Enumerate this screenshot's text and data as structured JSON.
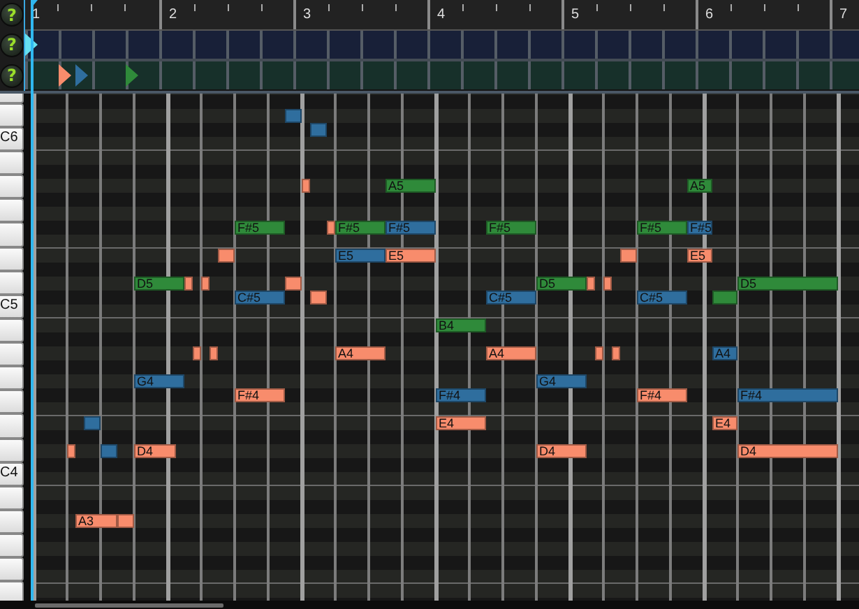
{
  "track_buttons": [
    {
      "symbol": "?"
    },
    {
      "symbol": "?"
    },
    {
      "symbol": "?"
    }
  ],
  "ruler": {
    "bars": [
      "1",
      "2",
      "3",
      "4",
      "5",
      "6",
      "7"
    ]
  },
  "tracks": [
    {
      "color": "#182038",
      "markers": [
        {
          "color": "#66e0f0"
        }
      ]
    },
    {
      "color": "#17302a",
      "markers": [
        {
          "color": "#f88c6c"
        },
        {
          "color": "#2f6e9e"
        },
        {
          "color": "#2f8a3a"
        }
      ]
    }
  ],
  "keyboard": {
    "labels": [
      "C6",
      "C5",
      "C4"
    ]
  },
  "notes": [
    {
      "color": "#2f6e9e"
    },
    {
      "color": "#2f6e9e"
    },
    {
      "color": "#f88c6c"
    },
    {
      "color": "#2f8a3a",
      "label": "A5"
    },
    {
      "color": "#2f8a3a",
      "label": "A5"
    },
    {
      "color": "#2f8a3a",
      "label": "F#5"
    },
    {
      "color": "#f88c6c"
    },
    {
      "color": "#2f8a3a",
      "label": "F#5"
    },
    {
      "color": "#2f6e9e",
      "label": "F#5"
    },
    {
      "color": "#2f8a3a",
      "label": "F#5"
    },
    {
      "color": "#2f8a3a",
      "label": "F#5"
    },
    {
      "color": "#2f6e9e",
      "label": "F#5"
    },
    {
      "color": "#f88c6c"
    },
    {
      "color": "#2f6e9e",
      "label": "E5"
    },
    {
      "color": "#f88c6c",
      "label": "E5"
    },
    {
      "color": "#f88c6c"
    },
    {
      "color": "#f88c6c",
      "label": "E5"
    },
    {
      "color": "#2f8a3a",
      "label": "D5"
    },
    {
      "color": "#f88c6c"
    },
    {
      "color": "#f88c6c"
    },
    {
      "color": "#f88c6c"
    },
    {
      "color": "#2f8a3a",
      "label": "D5"
    },
    {
      "color": "#f88c6c"
    },
    {
      "color": "#f88c6c"
    },
    {
      "color": "#2f8a3a",
      "label": "D5"
    },
    {
      "color": "#2f6e9e",
      "label": "C#5"
    },
    {
      "color": "#f88c6c"
    },
    {
      "color": "#2f6e9e",
      "label": "C#5"
    },
    {
      "color": "#2f6e9e",
      "label": "C#5"
    },
    {
      "color": "#2f8a3a"
    },
    {
      "color": "#2f8a3a",
      "label": "B4"
    },
    {
      "color": "#f88c6c"
    },
    {
      "color": "#f88c6c"
    },
    {
      "color": "#f88c6c",
      "label": "A4"
    },
    {
      "color": "#f88c6c",
      "label": "A4"
    },
    {
      "color": "#f88c6c"
    },
    {
      "color": "#f88c6c"
    },
    {
      "color": "#2f6e9e",
      "label": "A4"
    },
    {
      "color": "#2f6e9e",
      "label": "G4"
    },
    {
      "color": "#2f6e9e",
      "label": "G4"
    },
    {
      "color": "#f88c6c",
      "label": "F#4"
    },
    {
      "color": "#2f6e9e",
      "label": "F#4"
    },
    {
      "color": "#f88c6c",
      "label": "F#4"
    },
    {
      "color": "#2f6e9e",
      "label": "F#4"
    },
    {
      "color": "#2f6e9e"
    },
    {
      "color": "#f88c6c",
      "label": "E4"
    },
    {
      "color": "#f88c6c",
      "label": "E4"
    },
    {
      "color": "#f88c6c"
    },
    {
      "color": "#2f6e9e"
    },
    {
      "color": "#f88c6c",
      "label": "D4"
    },
    {
      "color": "#f88c6c",
      "label": "D4"
    },
    {
      "color": "#f88c6c",
      "label": "D4"
    },
    {
      "color": "#f88c6c",
      "label": "A3"
    },
    {
      "color": "#f88c6c"
    }
  ]
}
